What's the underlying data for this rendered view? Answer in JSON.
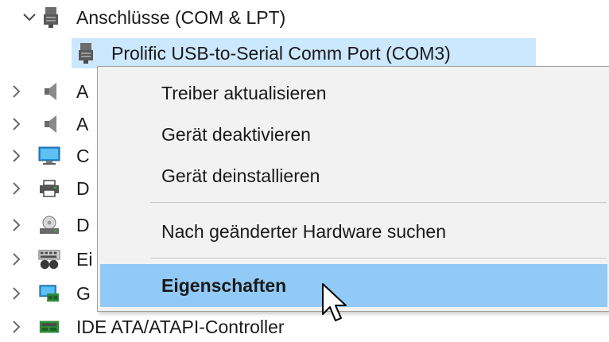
{
  "tree": {
    "ports_group": {
      "label": "Anschlüsse (COM & LPT)",
      "icon": "port-connector-icon",
      "expanded": true
    },
    "selected_device": {
      "label": "Prolific USB-to-Serial Comm Port (COM3)",
      "icon": "port-connector-icon"
    },
    "collapsed_items": [
      {
        "label": "A",
        "icon": "speaker-icon"
      },
      {
        "label": "A",
        "icon": "speaker-icon"
      },
      {
        "label": "C",
        "icon": "monitor-icon"
      },
      {
        "label": "D",
        "icon": "printer-icon"
      },
      {
        "label": "D",
        "icon": "disk-drive-icon"
      },
      {
        "label": "Ei",
        "icon": "keyboard-device-icon"
      },
      {
        "label": "G",
        "icon": "display-adapter-icon"
      }
    ],
    "ide_controller": {
      "label": "IDE ATA/ATAPI-Controller",
      "icon": "storage-controller-icon"
    }
  },
  "context_menu": {
    "items": [
      {
        "label": "Treiber aktualisieren"
      },
      {
        "label": "Gerät deaktivieren"
      },
      {
        "label": "Gerät deinstallieren"
      },
      {
        "label": "Nach geänderter Hardware suchen"
      },
      {
        "label": "Eigenschaften",
        "highlighted": true
      }
    ]
  },
  "colors": {
    "selection": "#cce8ff",
    "menu_highlight": "#91c9f7",
    "menu_background": "#f2f2f2"
  }
}
